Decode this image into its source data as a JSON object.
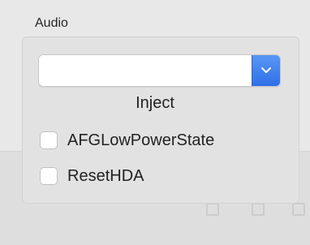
{
  "audio_group": {
    "title": "Audio",
    "combo_value": "",
    "combo_label": "Inject",
    "checkboxes": [
      {
        "label": "AFGLowPowerState",
        "checked": false
      },
      {
        "label": "ResetHDA",
        "checked": false
      }
    ]
  },
  "colors": {
    "accent": "#3b7cf0"
  }
}
